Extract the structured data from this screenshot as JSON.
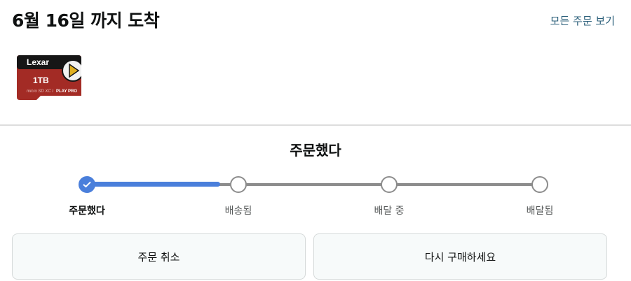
{
  "header": {
    "arrival_title": "6월 16일 까지 도착",
    "all_orders_link": "모든 주문 보기"
  },
  "product": {
    "image_brand": "Lexar",
    "image_capacity": "1TB",
    "image_line": "PLAY PRO",
    "image_text_small": "micro SD XC I"
  },
  "status": {
    "heading": "주문했다",
    "progress_fraction": 0.33,
    "steps": [
      {
        "label": "주문했다",
        "state": "done"
      },
      {
        "label": "배송됨",
        "state": "pending"
      },
      {
        "label": "배달 중",
        "state": "pending"
      },
      {
        "label": "배달됨",
        "state": "pending"
      }
    ]
  },
  "actions": {
    "cancel_label": "주문 취소",
    "reorder_label": "다시 구매하세요"
  },
  "colors": {
    "accent": "#4a7fdb",
    "link": "#2b5f7a",
    "track": "#8c8c8c"
  }
}
